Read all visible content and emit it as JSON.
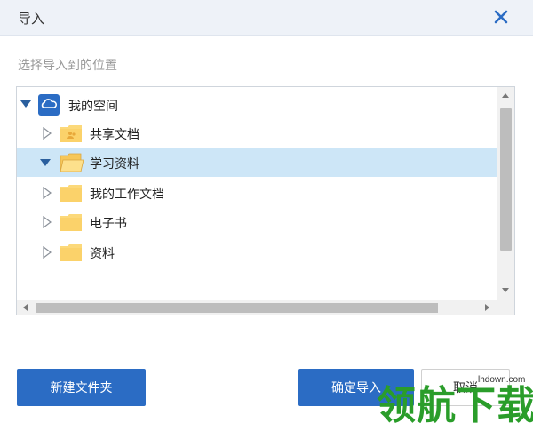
{
  "dialog": {
    "title": "导入",
    "subtitle": "选择导入到的位置"
  },
  "tree": {
    "root": {
      "label": "我的空间",
      "icon": "cloud-icon"
    },
    "children": [
      {
        "label": "共享文档",
        "icon": "shared-folder-icon",
        "expanded": false
      },
      {
        "label": "学习资料",
        "icon": "open-folder-icon",
        "expanded": true,
        "selected": true
      },
      {
        "label": "我的工作文档",
        "icon": "folder-icon",
        "expanded": false
      },
      {
        "label": "电子书",
        "icon": "folder-icon",
        "expanded": false
      },
      {
        "label": "资料",
        "icon": "folder-icon",
        "expanded": false
      }
    ]
  },
  "buttons": {
    "new_folder": "新建文件夹",
    "confirm": "确定导入",
    "cancel": "取消"
  },
  "watermark": {
    "text": "领航下载",
    "url": "lhdown.com"
  },
  "colors": {
    "primary": "#2b6cc4",
    "selected_row": "#cde6f7",
    "folder": "#fcd97a",
    "tree_arrow": "#2a5f9e"
  }
}
